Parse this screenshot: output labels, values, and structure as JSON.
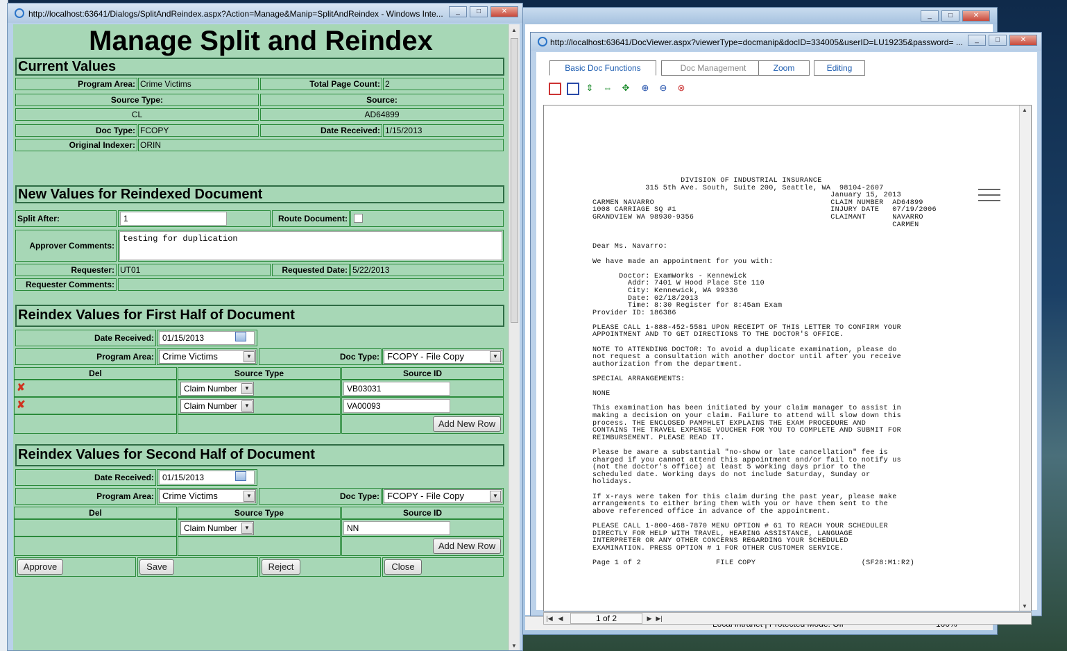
{
  "dialog": {
    "title": "http://localhost:63641/Dialogs/SplitAndReindex.aspx?Action=Manage&Manip=SplitAndReindex - Windows Inte...",
    "heading": "Manage Split and Reindex"
  },
  "current": {
    "section": "Current Values",
    "program_area_label": "Program Area:",
    "program_area": "Crime Victims",
    "total_page_count_label": "Total Page Count:",
    "total_page_count": "2",
    "source_type_label": "Source Type:",
    "source_type": "CL",
    "source_label": "Source:",
    "source": "AD64899",
    "doc_type_label": "Doc Type:",
    "doc_type": "FCOPY",
    "date_received_label": "Date Received:",
    "date_received": "1/15/2013",
    "original_indexer_label": "Original Indexer:",
    "original_indexer": "ORIN"
  },
  "newvals": {
    "section": "New Values for Reindexed Document",
    "split_after_label": "Split After:",
    "split_after": "1",
    "route_label": "Route Document:",
    "approver_label": "Approver Comments:",
    "approver_comments": "testing for duplication",
    "requester_label": "Requester:",
    "requester": "UT01",
    "requested_date_label": "Requested Date:",
    "requested_date": "5/22/2013",
    "requester_comments_label": "Requester Comments:"
  },
  "first": {
    "section": "Reindex Values for First Half of Document",
    "date_received_label": "Date Received:",
    "date_received": "01/15/2013",
    "program_area_label": "Program Area:",
    "program_area": "Crime Victims",
    "doc_type_label": "Doc Type:",
    "doc_type": "FCOPY - File Copy",
    "col_del": "Del",
    "col_source_type": "Source Type",
    "col_source_id": "Source ID",
    "rows": [
      {
        "source_type": "Claim Number",
        "source_id": "VB03031"
      },
      {
        "source_type": "Claim Number",
        "source_id": "VA00093"
      }
    ],
    "add_row": "Add New Row"
  },
  "second": {
    "section": "Reindex Values for Second Half of Document",
    "date_received_label": "Date Received:",
    "date_received": "01/15/2013",
    "program_area_label": "Program Area:",
    "program_area": "Crime Victims",
    "doc_type_label": "Doc Type:",
    "doc_type": "FCOPY - File Copy",
    "col_del": "Del",
    "col_source_type": "Source Type",
    "col_source_id": "Source ID",
    "rows": [
      {
        "source_type": "Claim Number",
        "source_id": "NN"
      }
    ],
    "add_row": "Add New Row"
  },
  "actions": {
    "approve": "Approve",
    "save": "Save",
    "reject": "Reject",
    "close": "Close"
  },
  "viewer": {
    "title": "http://localhost:63641/DocViewer.aspx?viewerType=docmanip&docID=334005&userID=LU19235&password= ...",
    "tabs": [
      "Basic Doc Functions",
      "Doc Management",
      "Zoom",
      "Editing"
    ],
    "page_indicator": "1 of 2",
    "document_text": "                    DIVISION OF INDUSTRIAL INSURANCE\n            315 5th Ave. South, Suite 200, Seattle, WA  98104-2607\n                                                      January 15, 2013\nCARMEN NAVARRO                                        CLAIM NUMBER  AD64899\n1008 CARRIAGE SQ #1                                   INJURY DATE   07/19/2006\nGRANDVIEW WA 98930-9356                               CLAIMANT      NAVARRO\n                                                                    CARMEN\n\n\nDear Ms. Navarro:\n\nWe have made an appointment for you with:\n\n      Doctor: ExamWorks - Kennewick\n        Addr: 7401 W Hood Place Ste 110\n        City: Kennewick, WA 99336\n        Date: 02/18/2013\n        Time: 8:30 Register for 8:45am Exam\nProvider ID: 186386\n\nPLEASE CALL 1-888-452-5581 UPON RECEIPT OF THIS LETTER TO CONFIRM YOUR\nAPPOINTMENT AND TO GET DIRECTIONS TO THE DOCTOR'S OFFICE.\n\nNOTE TO ATTENDING DOCTOR: To avoid a duplicate examination, please do\nnot request a consultation with another doctor until after you receive\nauthorization from the department.\n\nSPECIAL ARRANGEMENTS:\n\nNONE\n\nThis examination has been initiated by your claim manager to assist in\nmaking a decision on your claim. Failure to attend will slow down this\nprocess. THE ENCLOSED PAMPHLET EXPLAINS THE EXAM PROCEDURE AND\nCONTAINS THE TRAVEL EXPENSE VOUCHER FOR YOU TO COMPLETE AND SUBMIT FOR\nREIMBURSEMENT. PLEASE READ IT.\n\nPlease be aware a substantial \"no-show or late cancellation\" fee is\ncharged if you cannot attend this appointment and/or fail to notify us\n(not the doctor's office) at least 5 working days prior to the\nscheduled date. Working days do not include Saturday, Sunday or\nholidays.\n\nIf x-rays were taken for this claim during the past year, please make\narrangements to either bring them with you or have them sent to the\nabove referenced office in advance of the appointment.\n\nPLEASE CALL 1-800-468-7870 MENU OPTION # 61 TO REACH YOUR SCHEDULER\nDIRECTLY FOR HELP WITH TRAVEL, HEARING ASSISTANCE, LANGUAGE\nINTERPRETER OR ANY OTHER CONCERNS REGARDING YOUR SCHEDULED\nEXAMINATION. PRESS OPTION # 1 FOR OTHER CUSTOMER SERVICE.\n\nPage 1 of 2                 FILE COPY                        (SF28:M1:R2)"
  },
  "status_bar": {
    "zone": "Local intranet | Protected Mode: Off",
    "zoom": "100%"
  }
}
